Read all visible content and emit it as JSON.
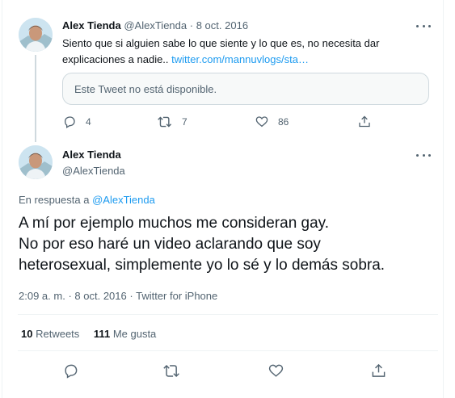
{
  "colors": {
    "accent": "#1d9bf0",
    "muted": "#536471",
    "text": "#0f1419",
    "border": "#cfd9de"
  },
  "parent_tweet": {
    "author_name": "Alex Tienda",
    "handle": "@AlexTienda",
    "separator": "·",
    "date": "8 oct. 2016",
    "text": "Siento que si alguien sabe lo que siente y lo que es, no necesita dar explicaciones a nadie..",
    "link": "twitter.com/mannuvlogs/sta…",
    "quoted_unavailable": "Este Tweet no está disponible.",
    "reply_count": "4",
    "retweet_count": "7",
    "like_count": "86",
    "icons": [
      "reply-icon",
      "retweet-icon",
      "like-icon",
      "share-icon"
    ]
  },
  "main_tweet": {
    "author_name": "Alex Tienda",
    "handle": "@AlexTienda",
    "reply_to_label": "En respuesta a",
    "reply_to_handle": "@AlexTienda",
    "text": "A mí por ejemplo muchos me consideran gay.\nNo por eso haré un video aclarando que soy\nheterosexual, simplemente yo lo sé y lo demás sobra.",
    "time": "2:09 a. m.",
    "separator": "·",
    "date": "8 oct. 2016",
    "separator2": "·",
    "source": "Twitter for iPhone",
    "retweets_count": "10",
    "retweets_label": "Retweets",
    "likes_count": "111",
    "likes_label": "Me gusta",
    "icons": [
      "reply-icon",
      "retweet-icon",
      "like-icon",
      "share-icon"
    ]
  }
}
